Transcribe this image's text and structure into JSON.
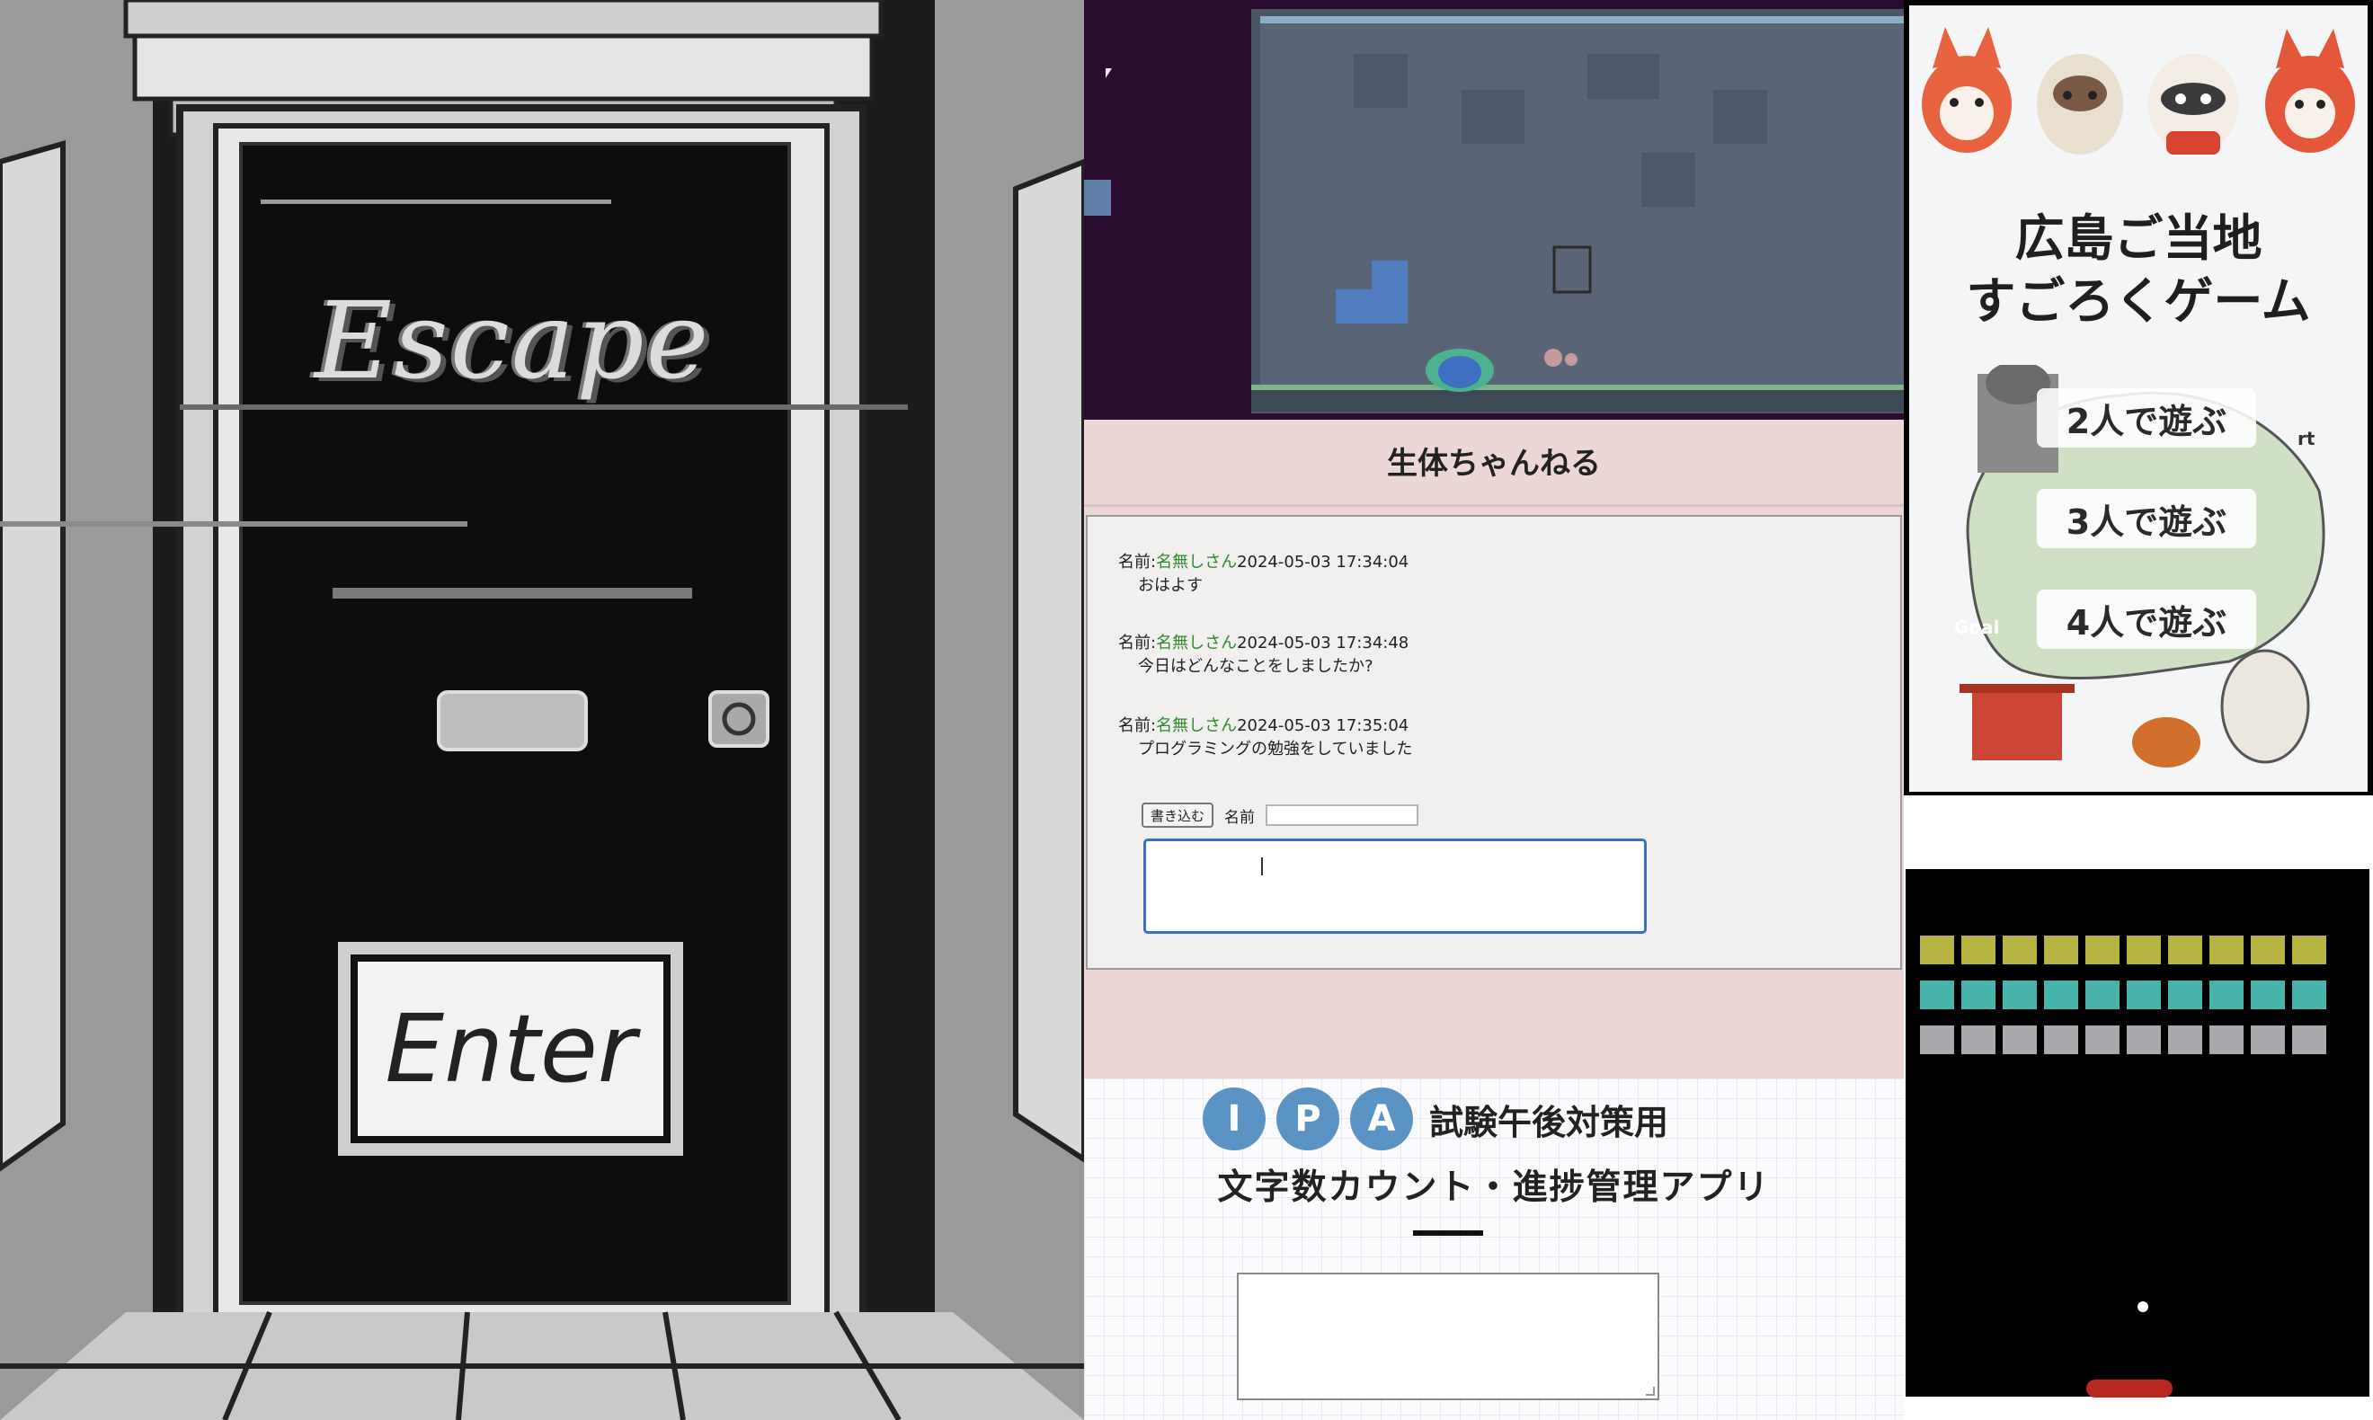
{
  "escape_game": {
    "title": "Escape",
    "enter_label": "Enter"
  },
  "bbs": {
    "title": "生体ちゃんねる",
    "posts": [
      {
        "label": "名前:",
        "name": "名無しさん",
        "timestamp": "2024-05-03 17:34:04",
        "message": "おはよす"
      },
      {
        "label": "名前:",
        "name": "名無しさん",
        "timestamp": "2024-05-03 17:34:48",
        "message": "今日はどんなことをしましたか?"
      },
      {
        "label": "名前:",
        "name": "名無しさん",
        "timestamp": "2024-05-03 17:35:04",
        "message": "プログラミングの勉強をしていました"
      }
    ],
    "form": {
      "submit_label": "書き込む",
      "name_label": "名前",
      "name_value": "",
      "message_value": ""
    }
  },
  "ipa_app": {
    "letters": [
      "I",
      "P",
      "A"
    ],
    "subtitle": "試験午後対策用",
    "title": "文字数カウント・進捗管理アプリ",
    "textarea_value": ""
  },
  "sugoroku": {
    "title_line1": "広島ご当地",
    "title_line2": "すごろくゲーム",
    "buttons": [
      "2人で遊ぶ",
      "3人で遊ぶ",
      "4人で遊ぶ"
    ],
    "map_labels": {
      "start": "rt",
      "goal": "Goal"
    }
  },
  "breakout": {
    "brick_colors": [
      "#b7b443",
      "#47b3ab",
      "#a9a9ad"
    ]
  },
  "colors": {
    "bbs_bg": "#ecd6d6",
    "bbs_name": "#2d8a2d",
    "ipa_circle": "#5b93c4",
    "paddle": "#b8281f"
  }
}
